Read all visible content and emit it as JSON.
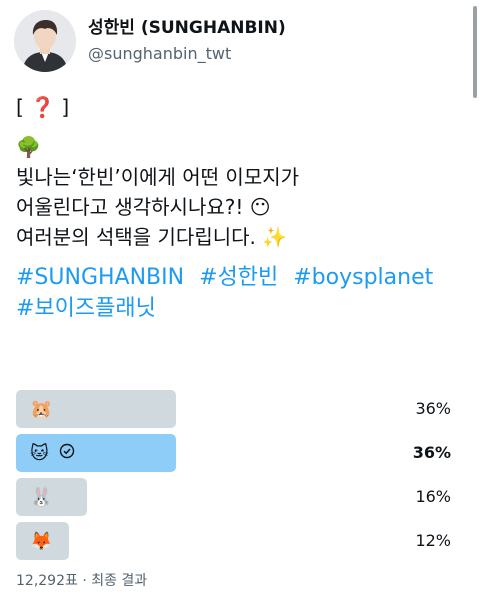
{
  "author": {
    "display_name": "성한빈 (SUNGHANBIN)",
    "handle": "@sunghanbin_twt"
  },
  "tweet": {
    "tag_line": "[ ❓ ]",
    "tree_emoji": "🌳",
    "line1": "빛나는‘한빈’이에게 어떤 이모지가",
    "line2": "어울린다고 생각하시나요?! 😶",
    "line3": "여러분의 석택을 기다립니다. ✨",
    "hashtags": [
      "#SUNGHANBIN",
      "#성한빈",
      "#boysplanet",
      "#보이즈플래닛"
    ]
  },
  "poll": {
    "options": [
      {
        "emoji": "🐹",
        "percent_label": "36%",
        "fraction": 0.36,
        "winner": false,
        "selected": false
      },
      {
        "emoji": "🐱",
        "percent_label": "36%",
        "fraction": 0.36,
        "winner": true,
        "selected": true
      },
      {
        "emoji": "🐰",
        "percent_label": "16%",
        "fraction": 0.16,
        "winner": false,
        "selected": false
      },
      {
        "emoji": "🦊",
        "percent_label": "12%",
        "fraction": 0.12,
        "winner": false,
        "selected": false
      }
    ],
    "footer": "12,292표 · 최종 결과"
  },
  "colors": {
    "bar_default": "#cfd9de",
    "bar_winner": "#8ecdf8",
    "link": "#1d9bf0"
  }
}
